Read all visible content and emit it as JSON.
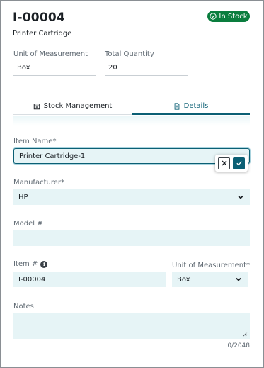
{
  "header": {
    "item_id": "I-00004",
    "item_name": "Printer Cartridge",
    "status": "In Stock",
    "status_color": "#0a7d3e",
    "status_icon": "check-circle-icon"
  },
  "summary": {
    "uom_label": "Unit of Measurement",
    "uom_value": "Box",
    "qty_label": "Total Quantity",
    "qty_value": "20"
  },
  "tabs": [
    {
      "label": "Stock Management",
      "icon": "warehouse-icon",
      "active": false
    },
    {
      "label": "Details",
      "icon": "document-icon",
      "active": true
    }
  ],
  "form": {
    "item_name": {
      "label": "Item Name*",
      "value": "Printer Cartridge-1"
    },
    "manufacturer": {
      "label": "Manufacturer*",
      "value": "HP"
    },
    "model": {
      "label": "Model #",
      "value": ""
    },
    "item_number": {
      "label": "Item #",
      "value": "I-00004",
      "icon": "info-icon"
    },
    "uom": {
      "label": "Unit of Measurement*",
      "value": "Box"
    },
    "notes": {
      "label": "Notes",
      "value": "",
      "counter": "0/2048"
    }
  },
  "edit_actions": {
    "cancel_icon": "close-icon",
    "confirm_icon": "checkmark-icon"
  },
  "colors": {
    "accent": "#0b5f74",
    "field_bg": "#e6f4f6"
  }
}
